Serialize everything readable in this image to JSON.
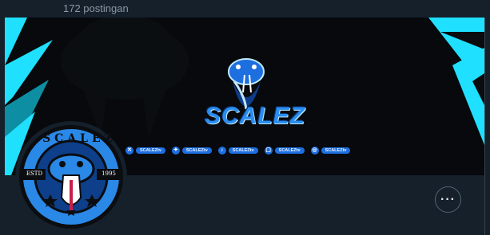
{
  "header": {
    "post_count": "172 postingan"
  },
  "banner": {
    "logo_text": "SCALEZ",
    "socials": [
      {
        "icon": "x-icon",
        "handle": "SCALEZtv"
      },
      {
        "icon": "twitter-icon",
        "handle": "SCALEZtv"
      },
      {
        "icon": "tiktok-icon",
        "handle": "SCALEZtv"
      },
      {
        "icon": "twitch-icon",
        "handle": "SCALEZtv"
      },
      {
        "icon": "instagram-icon",
        "handle": "SCALEZtv"
      }
    ]
  },
  "avatar": {
    "ring_text": "SCALEZ",
    "left_year": "ESTD",
    "right_year": "1995"
  },
  "actions": {
    "more_label": "···"
  },
  "colors": {
    "accent": "#1fe0ff",
    "brand_blue": "#1d6fe0",
    "background": "#15202b"
  }
}
